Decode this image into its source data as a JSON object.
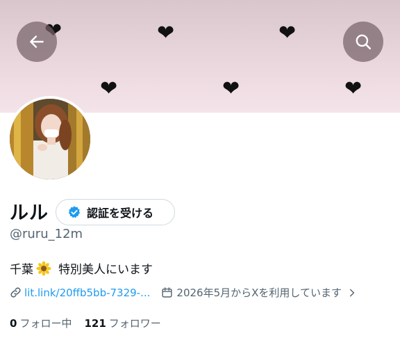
{
  "profile": {
    "name": "ルル",
    "handle": "@ruru_12m",
    "bio_prefix": "千葉",
    "bio_suffix": "特別美人にいます",
    "link": "lit.link/20ffb5bb-7329-...",
    "joined": "2026年5月からXを利用しています",
    "following_count": "0",
    "following_label": "フォロー中",
    "followers_count": "121",
    "followers_label": "フォロワー"
  },
  "actions": {
    "verify_label": "認証を受ける"
  },
  "icons": {
    "back": "arrow-left-icon",
    "search": "search-icon",
    "verified": "verified-badge-icon",
    "link": "link-icon",
    "calendar": "calendar-icon",
    "chevron": "chevron-right-icon",
    "flower": "sunflower-emoji-icon"
  },
  "colors": {
    "accent": "#1d9bf0",
    "secondary_text": "#536471",
    "banner": "#e3d0d6"
  }
}
